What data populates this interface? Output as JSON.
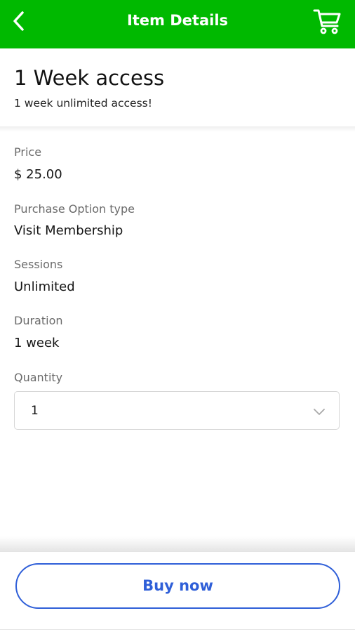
{
  "colors": {
    "header_bg": "#00b900",
    "header_text": "#ffffff",
    "accent_button": "#2f5fd8",
    "label_gray": "#6b6b6b"
  },
  "topbar": {
    "title": "Item Details",
    "back_icon": "chevron-left-icon",
    "cart_icon": "shopping-cart-icon"
  },
  "item": {
    "title": "1 Week access",
    "subtitle": "1 week unlimited access!"
  },
  "fields": {
    "price": {
      "label": "Price",
      "value": "$ 25.00"
    },
    "purchase_option": {
      "label": "Purchase Option type",
      "value": "Visit Membership"
    },
    "sessions": {
      "label": "Sessions",
      "value": "Unlimited"
    },
    "duration": {
      "label": "Duration",
      "value": "1 week"
    }
  },
  "quantity": {
    "label": "Quantity",
    "selected": "1",
    "chevron_icon": "chevron-down-icon"
  },
  "actions": {
    "buy_label": "Buy now"
  }
}
